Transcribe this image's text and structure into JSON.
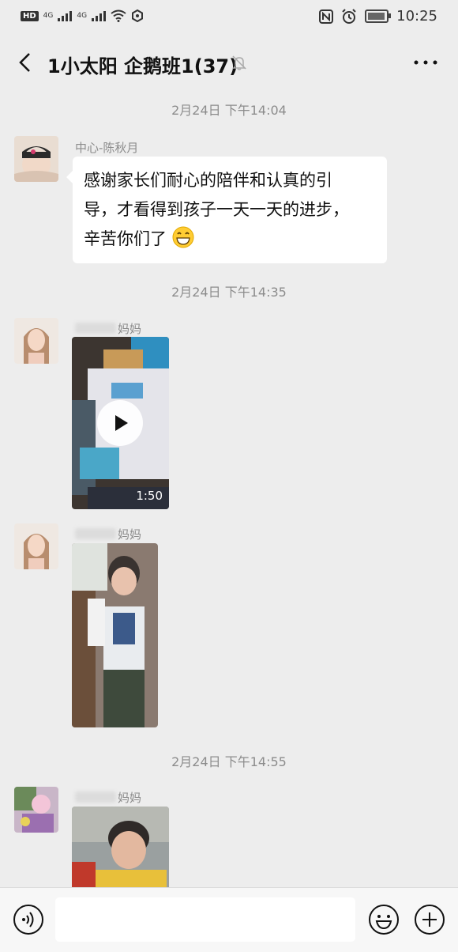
{
  "status_bar": {
    "hd": "HD",
    "net1": "4G",
    "net2": "4G",
    "time": "10:25"
  },
  "header": {
    "title": "1小太阳 企鹅班1(37)"
  },
  "messages": [
    {
      "timestamp": "2月24日 下午14:04",
      "sender": "中心-陈秋月",
      "text_line1": "感谢家长们耐心的陪伴和认真的引",
      "text_line2": "导，才看得到孩子一天一天的进步，",
      "text_line3": "辛苦你们了"
    },
    {
      "timestamp": "2月24日 下午14:35",
      "sender_suffix": "妈妈",
      "video_duration": "1:50"
    },
    {
      "sender_suffix": "妈妈"
    },
    {
      "timestamp": "2月24日 下午14:55",
      "sender_suffix": "妈妈"
    }
  ],
  "input": {
    "placeholder": ""
  },
  "colors": {
    "background": "#ededed",
    "bubble": "#ffffff",
    "meta_text": "#8c8c8c"
  }
}
